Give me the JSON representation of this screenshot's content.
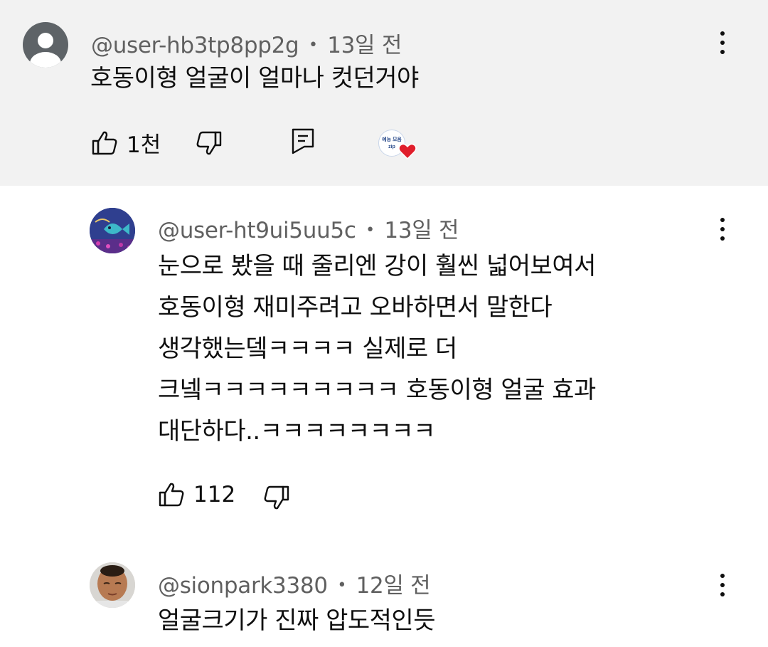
{
  "comments": [
    {
      "author": "@user-hb3tp8pp2g",
      "age": "13일 전",
      "lines": [
        "호동이형 얼굴이 얼마나 컷던거야"
      ],
      "likes": "1천",
      "creator_badge_text": [
        "예능 모음",
        "zip"
      ]
    },
    {
      "author": "@user-ht9ui5uu5c",
      "age": "13일 전",
      "lines": [
        "눈으로 봤을 때 줄리엔 강이 훨씬 넓어보여서",
        "호동이형 재미주려고 오바하면서 말한다",
        "생각했는뎈ㅋㅋㅋㅋ 실제로 더",
        "크넼ㅋㅋㅋㅋㅋㅋㅋㅋㅋ 호동이형 얼굴 효과",
        "대단하다..ㅋㅋㅋㅋㅋㅋㅋㅋ"
      ],
      "likes": "112"
    },
    {
      "author": "@sionpark3380",
      "age": "12일 전",
      "lines": [
        "얼굴크기가 진짜 압도적인듯"
      ]
    }
  ],
  "separator": "•",
  "colors": {
    "highlight_bg": "#f2f2f2",
    "meta_text": "#606060",
    "heart": "#e01e2b"
  },
  "icons": {
    "like": "thumbs-up-icon",
    "dislike": "thumbs-down-icon",
    "reply": "reply-icon",
    "more": "more-vertical-icon",
    "heart": "heart-icon"
  }
}
